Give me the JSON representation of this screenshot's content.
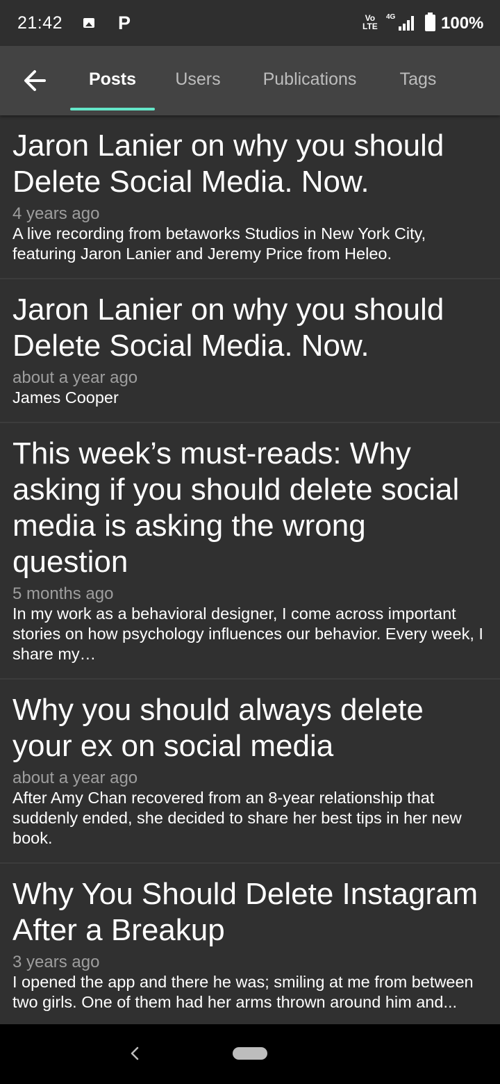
{
  "status_bar": {
    "time": "21:42",
    "volte_line1": "Vo",
    "volte_line2": "LTE",
    "network": "4G",
    "battery": "100%",
    "p_label": "P"
  },
  "app_bar": {
    "tabs": [
      {
        "label": "Posts",
        "active": true
      },
      {
        "label": "Users",
        "active": false
      },
      {
        "label": "Publications",
        "active": false
      },
      {
        "label": "Tags",
        "active": false
      }
    ],
    "accent_color": "#64e6c8"
  },
  "posts": [
    {
      "title": "Jaron Lanier on why you should Delete Social Media. Now.",
      "time": "4 years ago",
      "description": "A live recording from betaworks Studios in New York City, featuring Jaron Lanier and Jeremy Price from Heleo."
    },
    {
      "title": "Jaron Lanier on why you should Delete Social Media. Now.",
      "time": "about a year ago",
      "description": "James Cooper"
    },
    {
      "title": "This week’s must-reads: Why asking if you should delete social media is asking the wrong question",
      "time": "5 months ago",
      "description": "In my work as a behavioral designer, I come across important stories on how psychology influences our behavior. Every week, I share my…"
    },
    {
      "title": "Why you should always delete your ex on social media",
      "time": "about a year ago",
      "description": "After Amy Chan recovered from an 8-year relationship that suddenly ended, she decided to share her best tips in her new book."
    },
    {
      "title": "Why You Should Delete Instagram After a Breakup",
      "time": "3 years ago",
      "description": "I opened the app and there he was; smiling at me from between two girls. One of them had her arms thrown around him and..."
    }
  ]
}
